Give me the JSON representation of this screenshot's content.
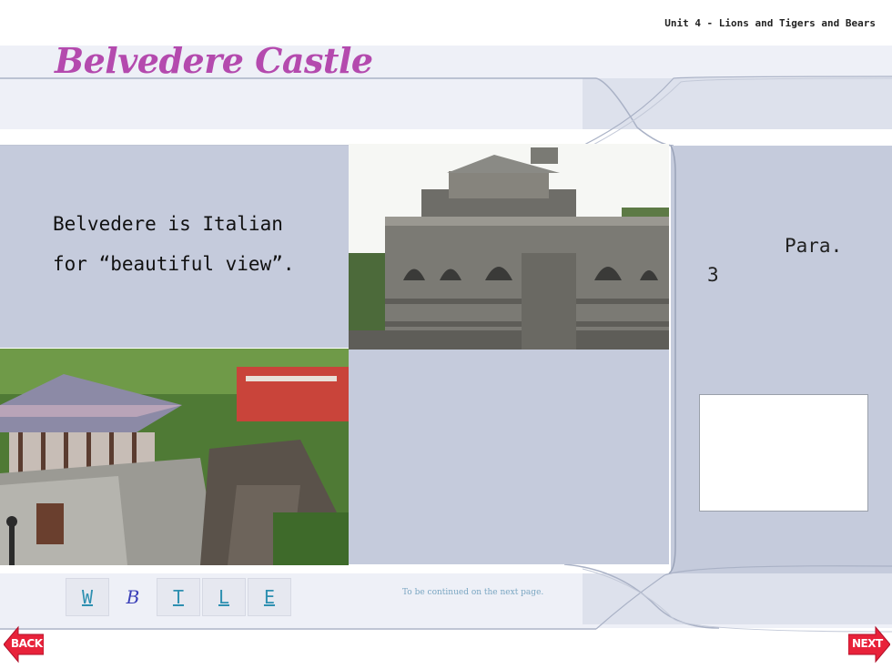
{
  "header": {
    "unit_title": "Unit 4 - Lions and Tigers and Bears"
  },
  "slide": {
    "title": "Belvedere Castle",
    "caption": "Belvedere is Italian\nfor “beautiful view”."
  },
  "side": {
    "para_word": "Para.",
    "para_number": "3"
  },
  "nav": {
    "links": [
      {
        "label": "W"
      },
      {
        "label": "B"
      },
      {
        "label": "T"
      },
      {
        "label": "L"
      },
      {
        "label": "E"
      }
    ],
    "continued_text": "To be continued on the next page.",
    "back_label": "BACK",
    "next_label": "NEXT"
  },
  "colors": {
    "title": "#b44aae",
    "panel": "#c5cbdc",
    "link": "#2d8fb0",
    "arrow": "#e8223a"
  }
}
